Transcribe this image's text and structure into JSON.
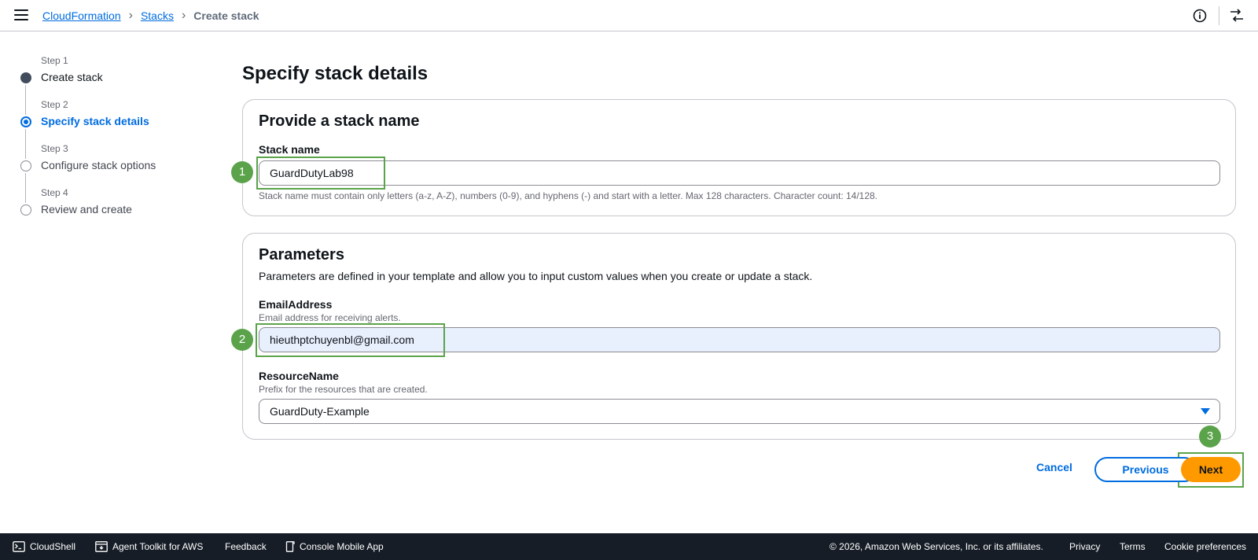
{
  "header": {
    "breadcrumb": [
      "CloudFormation",
      "Stacks",
      "Create stack"
    ],
    "icons": [
      "menu-icon",
      "info-icon",
      "panel-icon"
    ]
  },
  "steps": [
    {
      "num": "Step 1",
      "label": "Create stack",
      "state": "done"
    },
    {
      "num": "Step 2",
      "label": "Specify stack details",
      "state": "current"
    },
    {
      "num": "Step 3",
      "label": "Configure stack options",
      "state": "pending"
    },
    {
      "num": "Step 4",
      "label": "Review and create",
      "state": "pending"
    }
  ],
  "page": {
    "title": "Specify stack details"
  },
  "stack_name_section": {
    "title": "Provide a stack name",
    "label": "Stack name",
    "value": "GuardDutyLab98",
    "constraint": "Stack name must contain only letters (a-z, A-Z), numbers (0-9), and hyphens (-) and start with a letter. Max 128 characters. Character count: 14/128."
  },
  "parameters": {
    "title": "Parameters",
    "description": "Parameters are defined in your template and allow you to input custom values when you create or update a stack.",
    "email": {
      "label": "EmailAddress",
      "description": "Email address for receiving alerts.",
      "value": "hieuthptchuyenbl@gmail.com"
    },
    "resource": {
      "label": "ResourceName",
      "description": "Prefix for the resources that are created.",
      "value": "GuardDuty-Example"
    }
  },
  "annotations": [
    "1",
    "2",
    "3"
  ],
  "actions": {
    "cancel": "Cancel",
    "previous": "Previous",
    "next": "Next"
  },
  "footer": {
    "cloudshell": "CloudShell",
    "toolkit": "Agent Toolkit for AWS",
    "feedback": "Feedback",
    "mobile": "Console Mobile App",
    "copyright": "© 2026, Amazon Web Services, Inc. or its affiliates.",
    "privacy": "Privacy",
    "terms": "Terms",
    "cookies": "Cookie preferences"
  },
  "colors": {
    "accent": "#006ce0",
    "primary_button": "#ff9900",
    "annotation": "#5ba34a",
    "footer_bg": "#161d26"
  }
}
